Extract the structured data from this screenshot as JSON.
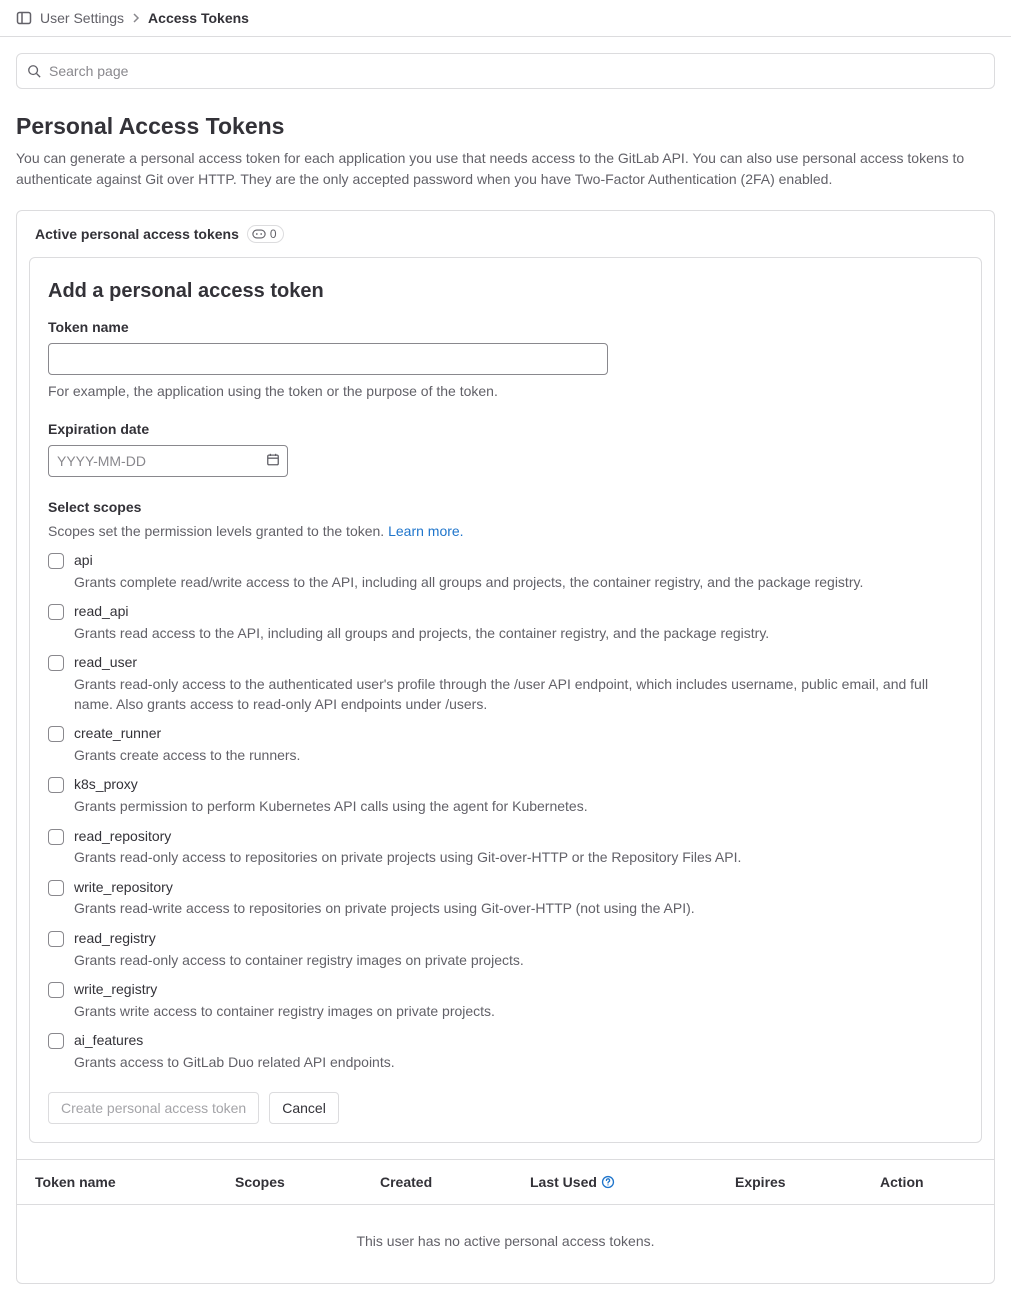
{
  "breadcrumb": {
    "parent": "User Settings",
    "current": "Access Tokens"
  },
  "search": {
    "placeholder": "Search page"
  },
  "page": {
    "title": "Personal Access Tokens",
    "description": "You can generate a personal access token for each application you use that needs access to the GitLab API. You can also use personal access tokens to authenticate against Git over HTTP. They are the only accepted password when you have Two-Factor Authentication (2FA) enabled."
  },
  "active_header": {
    "label": "Active personal access tokens",
    "count": "0"
  },
  "form": {
    "title": "Add a personal access token",
    "token_name_label": "Token name",
    "token_name_hint": "For example, the application using the token or the purpose of the token.",
    "expiration_label": "Expiration date",
    "expiration_placeholder": "YYYY-MM-DD",
    "scopes_label": "Select scopes",
    "scopes_desc": "Scopes set the permission levels granted to the token. ",
    "learn_more": "Learn more.",
    "create_button": "Create personal access token",
    "cancel_button": "Cancel"
  },
  "scopes": [
    {
      "name": "api",
      "desc": "Grants complete read/write access to the API, including all groups and projects, the container registry, and the package registry."
    },
    {
      "name": "read_api",
      "desc": "Grants read access to the API, including all groups and projects, the container registry, and the package registry."
    },
    {
      "name": "read_user",
      "desc": "Grants read-only access to the authenticated user's profile through the /user API endpoint, which includes username, public email, and full name. Also grants access to read-only API endpoints under /users."
    },
    {
      "name": "create_runner",
      "desc": "Grants create access to the runners."
    },
    {
      "name": "k8s_proxy",
      "desc": "Grants permission to perform Kubernetes API calls using the agent for Kubernetes."
    },
    {
      "name": "read_repository",
      "desc": "Grants read-only access to repositories on private projects using Git-over-HTTP or the Repository Files API."
    },
    {
      "name": "write_repository",
      "desc": "Grants read-write access to repositories on private projects using Git-over-HTTP (not using the API)."
    },
    {
      "name": "read_registry",
      "desc": "Grants read-only access to container registry images on private projects."
    },
    {
      "name": "write_registry",
      "desc": "Grants write access to container registry images on private projects."
    },
    {
      "name": "ai_features",
      "desc": "Grants access to GitLab Duo related API endpoints."
    }
  ],
  "table": {
    "columns": {
      "name": "Token name",
      "scopes": "Scopes",
      "created": "Created",
      "last_used": "Last Used",
      "expires": "Expires",
      "action": "Action"
    },
    "empty": "This user has no active personal access tokens."
  }
}
